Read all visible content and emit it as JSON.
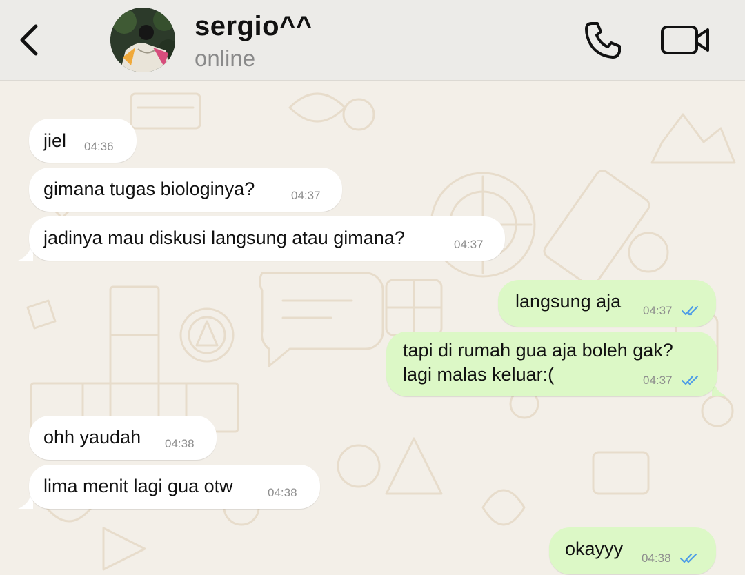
{
  "header": {
    "back_icon": "chevron-left-icon",
    "contact_name": "sergio^^",
    "status": "online",
    "call_icon": "phone-icon",
    "video_icon": "video-camera-icon"
  },
  "colors": {
    "header_bg": "#ecebe8",
    "wallpaper_bg": "#f3efe8",
    "incoming_bubble": "#ffffff",
    "outgoing_bubble": "#dcf8c6",
    "read_tick": "#4f9de6"
  },
  "messages": [
    {
      "direction": "in",
      "text": "jiel",
      "time": "04:36"
    },
    {
      "direction": "in",
      "text": "gimana tugas biologinya?",
      "time": "04:37"
    },
    {
      "direction": "in",
      "text": "jadinya mau diskusi langsung atau gimana?",
      "time": "04:37"
    },
    {
      "direction": "out",
      "text": "langsung aja",
      "time": "04:37",
      "status": "read"
    },
    {
      "direction": "out",
      "text_lines": [
        "tapi di rumah gua aja boleh gak?",
        "lagi malas keluar:("
      ],
      "time": "04:37",
      "status": "read"
    },
    {
      "direction": "in",
      "text": "ohh yaudah",
      "time": "04:38"
    },
    {
      "direction": "in",
      "text": "lima menit lagi gua otw",
      "time": "04:38"
    },
    {
      "direction": "out",
      "text": "okayyy",
      "time": "04:38",
      "status": "read"
    }
  ]
}
